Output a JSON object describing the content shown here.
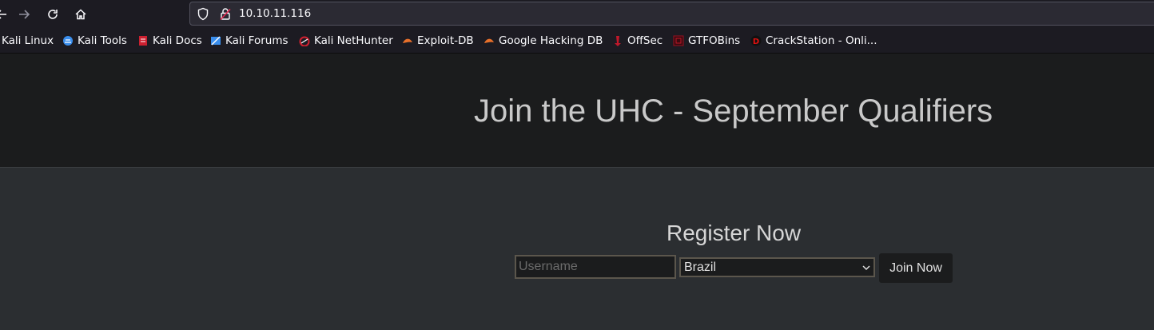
{
  "browser": {
    "url": "10.10.11.116",
    "bookmarks": [
      {
        "label": "Kali Linux",
        "icon": "kali-linux-icon",
        "color": "#3a8eed"
      },
      {
        "label": "Kali Tools",
        "icon": "kali-tools-icon",
        "color": "#3a8eed"
      },
      {
        "label": "Kali Docs",
        "icon": "kali-docs-icon",
        "color": "#cc2030"
      },
      {
        "label": "Kali Forums",
        "icon": "kali-forums-icon",
        "color": "#3a8eed"
      },
      {
        "label": "Kali NetHunter",
        "icon": "kali-nethunter-icon",
        "color": "#d02030"
      },
      {
        "label": "Exploit-DB",
        "icon": "exploit-db-icon",
        "color": "#e8702a"
      },
      {
        "label": "Google Hacking DB",
        "icon": "ghdb-icon",
        "color": "#e8702a"
      },
      {
        "label": "OffSec",
        "icon": "offsec-icon",
        "color": "#c0182a"
      },
      {
        "label": "GTFOBins",
        "icon": "gtfobins-icon",
        "color": "#9a1020"
      },
      {
        "label": "CrackStation - Onli...",
        "icon": "crackstation-icon",
        "color": "#e01010"
      }
    ]
  },
  "page": {
    "title": "Join the UHC - September Qualifiers",
    "register_heading": "Register Now",
    "username_placeholder": "Username",
    "username_value": "",
    "country_selected": "Brazil",
    "join_button": "Join Now"
  }
}
